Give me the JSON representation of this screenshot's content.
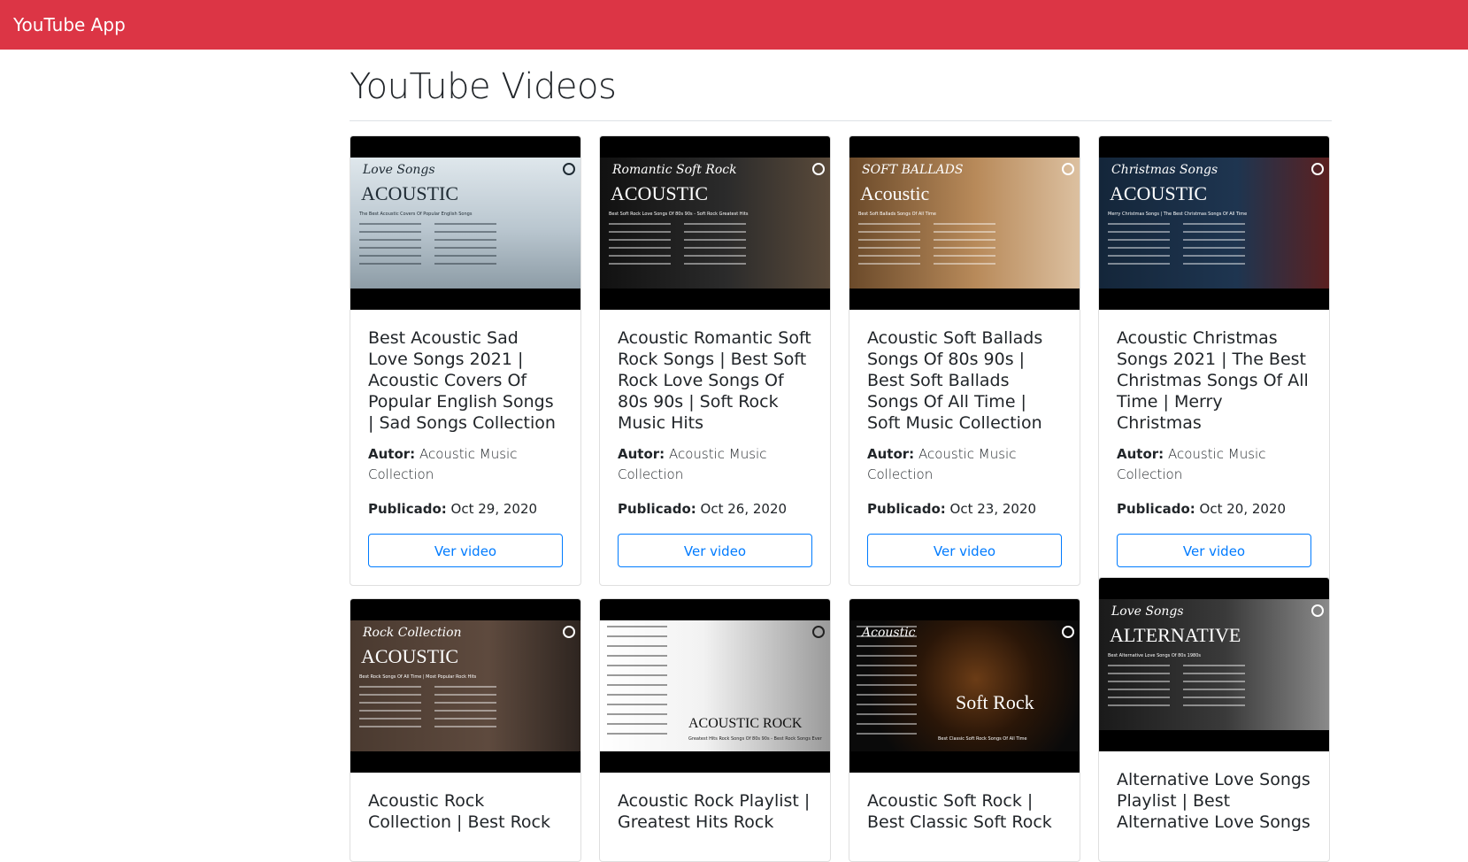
{
  "app": {
    "brand": "YouTube App",
    "accent": "#dc3545"
  },
  "page": {
    "title": "YouTube Videos"
  },
  "labels": {
    "author": "Autor:",
    "published": "Publicado:",
    "button": "Ver video"
  },
  "videos": [
    {
      "title": "Best Acoustic Sad Love Songs 2021 | Acoustic Covers Of Popular English Songs | Sad Songs Collection",
      "author": "Acoustic Music Collection",
      "date": "Oct 29, 2020",
      "thumb_script": "Love Songs",
      "thumb_big": "ACOUSTIC",
      "thumb_sub": "The Best Acoustic Covers Of Popular English Songs",
      "thumb_theme": "sky"
    },
    {
      "title": "Acoustic Romantic Soft Rock Songs | Best Soft Rock Love Songs Of 80s 90s | Soft Rock Music Hits",
      "author": "Acoustic Music Collection",
      "date": "Oct 26, 2020",
      "thumb_script": "Romantic Soft Rock",
      "thumb_big": "ACOUSTIC",
      "thumb_sub": "Best Soft Rock Love Songs Of 80s 90s - Soft Rock Greatest Hits",
      "thumb_theme": "dark"
    },
    {
      "title": "Acoustic Soft Ballads Songs Of 80s 90s | Best Soft Ballads Songs Of All Time | Soft Music Collection",
      "author": "Acoustic Music Collection",
      "date": "Oct 23, 2020",
      "thumb_script": "SOFT BALLADS",
      "thumb_big": "Acoustic",
      "thumb_sub": "Best Soft Ballads Songs Of All Time",
      "thumb_theme": "warm"
    },
    {
      "title": "Acoustic Christmas Songs 2021 | The Best Christmas Songs Of All Time | Merry Christmas",
      "author": "Acoustic Music Collection",
      "date": "Oct 20, 2020",
      "thumb_script": "Christmas Songs",
      "thumb_big": "ACOUSTIC",
      "thumb_sub": "Merry Christmas Songs | The Best Christmas Songs Of All Time",
      "thumb_theme": "navy"
    },
    {
      "title": "Acoustic Rock Collection | Best Rock",
      "thumb_script": "Rock Collection",
      "thumb_big": "ACOUSTIC",
      "thumb_sub": "Best Rock Songs Of All Time | Most Popular Rock Hits",
      "thumb_theme": "brown"
    },
    {
      "title": "Acoustic Rock Playlist | Greatest Hits Rock",
      "thumb_script": "",
      "thumb_big": "ACOUSTIC ROCK",
      "thumb_sub": "Greatest Hits Rock Songs Of 80s 90s - Best Rock Songs Ever",
      "thumb_theme": "light"
    },
    {
      "title": "Acoustic Soft Rock | Best Classic Soft Rock",
      "thumb_script": "Acoustic",
      "thumb_big": "Soft Rock",
      "thumb_sub": "Best Classic Soft Rock Songs Of All Time",
      "thumb_theme": "black"
    },
    {
      "title": "Alternative Love Songs Playlist | Best Alternative Love Songs",
      "thumb_script": "Love Songs",
      "thumb_big": "ALTERNATIVE",
      "thumb_sub": "Best Alternative Love Songs Of 80s 1980s",
      "thumb_theme": "grey"
    }
  ]
}
